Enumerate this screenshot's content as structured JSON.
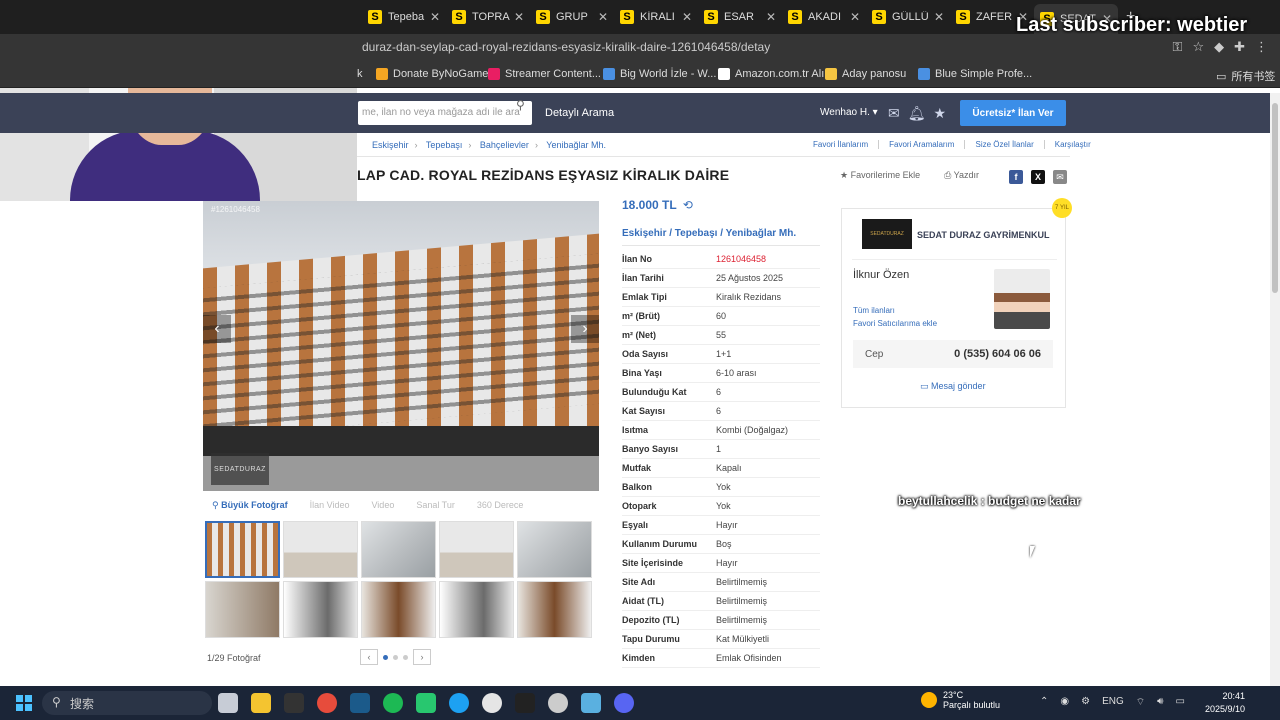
{
  "browser": {
    "tabs": [
      {
        "label": "Tepeba"
      },
      {
        "label": "TOPRA"
      },
      {
        "label": "GRUP"
      },
      {
        "label": "KİRALI"
      },
      {
        "label": "ESAR"
      },
      {
        "label": "AKADI"
      },
      {
        "label": "GÜLLÜ"
      },
      {
        "label": "ZAFER"
      },
      {
        "label": "SEDAT"
      }
    ],
    "favicon_letter": "S",
    "url": "duraz-dan-seylap-cad-royal-rezidans-esyasiz-kiralik-daire-1261046458/detay",
    "bookmarks": [
      {
        "label": "k",
        "color": ""
      },
      {
        "label": "Donate ByNoGame",
        "color": "#f5a623"
      },
      {
        "label": "Streamer Content...",
        "color": "#e91e63"
      },
      {
        "label": "Big World İzle - W...",
        "color": "#4a90e2"
      },
      {
        "label": "Amazon.com.tr Alı...",
        "color": "#ffffff"
      },
      {
        "label": "Aday panosu",
        "color": "#f5c542"
      },
      {
        "label": "Blue Simple Profe...",
        "color": "#4a90e2"
      },
      {
        "label": "所有书签",
        "color": ""
      }
    ]
  },
  "overlay": {
    "subscriber": "Last subscriber: webtier",
    "chat": "beytullahcelik : budget ne kadar"
  },
  "site": {
    "search_placeholder": "me, ilan no veya mağaza adı ile ara",
    "advanced_search": "Detaylı Arama",
    "user": "Wenhao H.",
    "post_button": "Ücretsiz* İlan Ver"
  },
  "breadcrumb": [
    "Eskişehir",
    "Tepebaşı",
    "Bahçelievler",
    "Yenibağlar Mh."
  ],
  "right_links": [
    "Favori İlanlarım",
    "Favori Aramalarım",
    "Size Özel İlanlar",
    "Karşılaştır"
  ],
  "listing": {
    "title": "LAP CAD. ROYAL REZİDANS EŞYASIZ KİRALIK DAİRE",
    "add_favorites": "Favorilerime Ekle",
    "print": "Yazdır",
    "price": "18.000 TL",
    "location": "Eskişehir  /  Tepebaşı  /  Yenibağlar Mh."
  },
  "gallery": {
    "photo_id": "#1261046458",
    "watermark": "SEDATDURAZ",
    "tabs": [
      "Büyük Fotoğraf",
      "İlan Video",
      "Video",
      "Sanal Tur",
      "360 Derece"
    ],
    "counter": "1/29 Fotoğraf"
  },
  "details": [
    {
      "k": "İlan No",
      "v": "1261046458"
    },
    {
      "k": "İlan Tarihi",
      "v": "25 Ağustos 2025"
    },
    {
      "k": "Emlak Tipi",
      "v": "Kiralık Rezidans"
    },
    {
      "k": "m² (Brüt)",
      "v": "60"
    },
    {
      "k": "m² (Net)",
      "v": "55"
    },
    {
      "k": "Oda Sayısı",
      "v": "1+1"
    },
    {
      "k": "Bina Yaşı",
      "v": "6-10 arası"
    },
    {
      "k": "Bulunduğu Kat",
      "v": "6"
    },
    {
      "k": "Kat Sayısı",
      "v": "6"
    },
    {
      "k": "Isıtma",
      "v": "Kombi (Doğalgaz)"
    },
    {
      "k": "Banyo Sayısı",
      "v": "1"
    },
    {
      "k": "Mutfak",
      "v": "Kapalı"
    },
    {
      "k": "Balkon",
      "v": "Yok"
    },
    {
      "k": "Otopark",
      "v": "Yok"
    },
    {
      "k": "Eşyalı",
      "v": "Hayır"
    },
    {
      "k": "Kullanım Durumu",
      "v": "Boş"
    },
    {
      "k": "Site İçerisinde",
      "v": "Hayır"
    },
    {
      "k": "Site Adı",
      "v": "Belirtilmemiş"
    },
    {
      "k": "Aidat (TL)",
      "v": "Belirtilmemiş"
    },
    {
      "k": "Depozito (TL)",
      "v": "Belirtilmemiş"
    },
    {
      "k": "Tapu Durumu",
      "v": "Kat Mülkiyetli"
    },
    {
      "k": "Kimden",
      "v": "Emlak Ofisinden"
    }
  ],
  "seller": {
    "logo_text": "SEDATDURAZ",
    "store": "SEDAT DURAZ GAYRİMENKUL",
    "badge": "7 YIL",
    "agent": "İlknur Özen",
    "all_listings": "Tüm ilanları",
    "add_fav_seller": "Favori Satıcılarıma ekle",
    "phone_label": "Cep",
    "phone": "0 (535) 604 06 06",
    "message": "Mesaj gönder"
  },
  "taskbar": {
    "search": "搜索",
    "temp": "23°C",
    "weather": "Parçalı bulutlu",
    "lang": "ENG",
    "time": "20:41",
    "date": "2025/9/10"
  },
  "colors": {
    "header": "#3b4257",
    "accent": "#356dba",
    "post_button": "#3b8ee8",
    "tab_favicon": "#ffd600"
  }
}
